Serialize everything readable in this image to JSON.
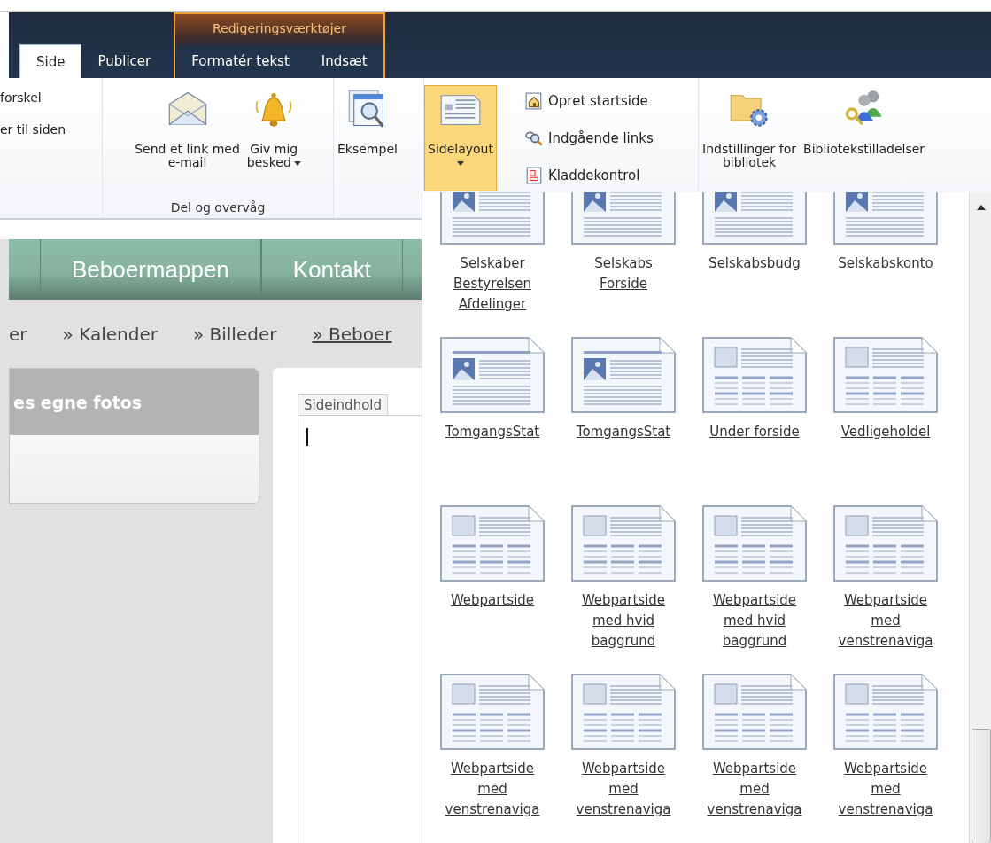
{
  "ribbon": {
    "tabs": [
      {
        "label": "Side",
        "selected": true
      },
      {
        "label": "Publicer",
        "selected": false
      }
    ],
    "context_group": {
      "label": "Redigeringsværktøjer",
      "tabs": [
        {
          "label": "Formatér tekst",
          "selected": false
        },
        {
          "label": "Indsæt",
          "selected": false
        }
      ]
    },
    "cut_labels": [
      "forskel",
      "er til siden"
    ],
    "sections": [
      {
        "label": "Del og overvåg",
        "buttons": [
          {
            "kind": "email",
            "lines": [
              "Send et link med",
              "e-mail"
            ],
            "dropdown": false,
            "selected": false
          },
          {
            "kind": "bell",
            "lines": [
              "Giv mig",
              "besked"
            ],
            "dropdown": true,
            "selected": false
          }
        ]
      },
      {
        "buttons": [
          {
            "kind": "preview",
            "lines": [
              "Eksempel"
            ],
            "dropdown": false,
            "selected": false
          }
        ]
      },
      {
        "buttons": [
          {
            "kind": "layout",
            "lines": [
              "Sidelayout"
            ],
            "dropdown": true,
            "selected": true
          }
        ]
      },
      {
        "small_buttons": [
          {
            "kind": "home",
            "label": "Opret startside"
          },
          {
            "kind": "links",
            "label": "Indgående links"
          },
          {
            "kind": "draft",
            "label": "Kladdekontrol"
          }
        ]
      },
      {
        "buttons": [
          {
            "kind": "folder-settings",
            "lines": [
              "Indstillinger for",
              "bibliotek"
            ],
            "dropdown": false,
            "selected": false
          },
          {
            "kind": "permissions",
            "lines": [
              "Bibliotekstilladelser"
            ],
            "dropdown": false,
            "selected": false
          }
        ]
      }
    ]
  },
  "site_nav": [
    {
      "label": "Beboermappen"
    },
    {
      "label": "Kontakt"
    }
  ],
  "breadcrumb": [
    {
      "label": "er",
      "selected": false
    },
    {
      "label": "» Kalender",
      "selected": false
    },
    {
      "label": "» Billeder",
      "selected": false
    },
    {
      "label": "» Beboer",
      "selected": true
    }
  ],
  "side_panel": {
    "title": "es egne fotos"
  },
  "editor": {
    "tab_label": "Sideindhold"
  },
  "layout_gallery": [
    {
      "kind": "photo",
      "lines": [
        "Selskaber",
        "Bestyrelsen",
        "Afdelinger"
      ]
    },
    {
      "kind": "photo",
      "lines": [
        "Selskabs",
        "Forside"
      ]
    },
    {
      "kind": "photo",
      "lines": [
        "Selskabsbudg"
      ]
    },
    {
      "kind": "photo",
      "lines": [
        "Selskabskonto"
      ]
    },
    {
      "kind": "photo",
      "lines": [
        "TomgangsStat"
      ]
    },
    {
      "kind": "photo",
      "lines": [
        "TomgangsStat"
      ]
    },
    {
      "kind": "grid",
      "lines": [
        "Under forside"
      ]
    },
    {
      "kind": "grid",
      "lines": [
        "Vedligeholdel"
      ]
    },
    {
      "kind": "grid",
      "lines": [
        "Webpartside"
      ]
    },
    {
      "kind": "grid",
      "lines": [
        "Webpartside",
        "med hvid",
        "baggrund"
      ]
    },
    {
      "kind": "grid",
      "lines": [
        "Webpartside",
        "med hvid",
        "baggrund"
      ]
    },
    {
      "kind": "grid",
      "lines": [
        "Webpartside",
        "med",
        "venstrenaviga"
      ]
    },
    {
      "kind": "grid",
      "lines": [
        "Webpartside",
        "med",
        "venstrenaviga"
      ]
    },
    {
      "kind": "grid",
      "lines": [
        "Webpartside",
        "med",
        "venstrenaviga"
      ]
    },
    {
      "kind": "grid",
      "lines": [
        "Webpartside",
        "med",
        "venstrenaviga"
      ]
    },
    {
      "kind": "grid",
      "lines": [
        "Webpartside",
        "med",
        "venstrenaviga"
      ]
    }
  ]
}
